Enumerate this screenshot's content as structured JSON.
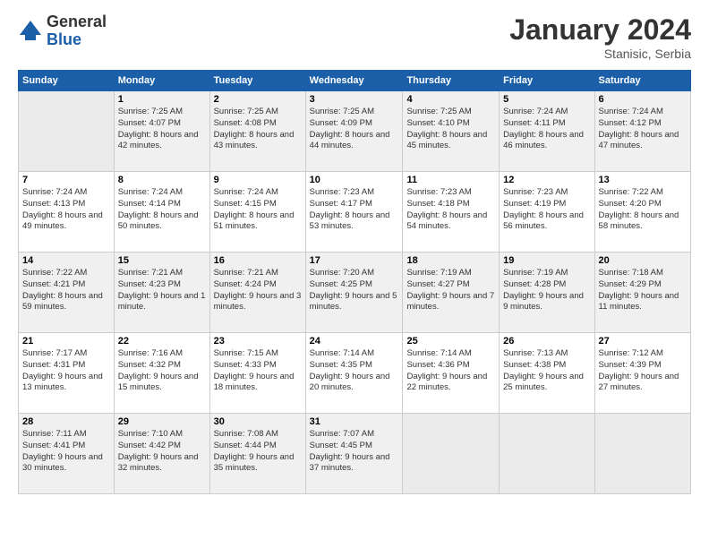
{
  "header": {
    "logo_general": "General",
    "logo_blue": "Blue",
    "month_title": "January 2024",
    "location": "Stanisic, Serbia"
  },
  "days_of_week": [
    "Sunday",
    "Monday",
    "Tuesday",
    "Wednesday",
    "Thursday",
    "Friday",
    "Saturday"
  ],
  "weeks": [
    [
      {
        "day": "",
        "empty": true
      },
      {
        "day": "1",
        "sunrise": "Sunrise: 7:25 AM",
        "sunset": "Sunset: 4:07 PM",
        "daylight": "Daylight: 8 hours and 42 minutes."
      },
      {
        "day": "2",
        "sunrise": "Sunrise: 7:25 AM",
        "sunset": "Sunset: 4:08 PM",
        "daylight": "Daylight: 8 hours and 43 minutes."
      },
      {
        "day": "3",
        "sunrise": "Sunrise: 7:25 AM",
        "sunset": "Sunset: 4:09 PM",
        "daylight": "Daylight: 8 hours and 44 minutes."
      },
      {
        "day": "4",
        "sunrise": "Sunrise: 7:25 AM",
        "sunset": "Sunset: 4:10 PM",
        "daylight": "Daylight: 8 hours and 45 minutes."
      },
      {
        "day": "5",
        "sunrise": "Sunrise: 7:24 AM",
        "sunset": "Sunset: 4:11 PM",
        "daylight": "Daylight: 8 hours and 46 minutes."
      },
      {
        "day": "6",
        "sunrise": "Sunrise: 7:24 AM",
        "sunset": "Sunset: 4:12 PM",
        "daylight": "Daylight: 8 hours and 47 minutes."
      }
    ],
    [
      {
        "day": "7",
        "sunrise": "Sunrise: 7:24 AM",
        "sunset": "Sunset: 4:13 PM",
        "daylight": "Daylight: 8 hours and 49 minutes."
      },
      {
        "day": "8",
        "sunrise": "Sunrise: 7:24 AM",
        "sunset": "Sunset: 4:14 PM",
        "daylight": "Daylight: 8 hours and 50 minutes."
      },
      {
        "day": "9",
        "sunrise": "Sunrise: 7:24 AM",
        "sunset": "Sunset: 4:15 PM",
        "daylight": "Daylight: 8 hours and 51 minutes."
      },
      {
        "day": "10",
        "sunrise": "Sunrise: 7:23 AM",
        "sunset": "Sunset: 4:17 PM",
        "daylight": "Daylight: 8 hours and 53 minutes."
      },
      {
        "day": "11",
        "sunrise": "Sunrise: 7:23 AM",
        "sunset": "Sunset: 4:18 PM",
        "daylight": "Daylight: 8 hours and 54 minutes."
      },
      {
        "day": "12",
        "sunrise": "Sunrise: 7:23 AM",
        "sunset": "Sunset: 4:19 PM",
        "daylight": "Daylight: 8 hours and 56 minutes."
      },
      {
        "day": "13",
        "sunrise": "Sunrise: 7:22 AM",
        "sunset": "Sunset: 4:20 PM",
        "daylight": "Daylight: 8 hours and 58 minutes."
      }
    ],
    [
      {
        "day": "14",
        "sunrise": "Sunrise: 7:22 AM",
        "sunset": "Sunset: 4:21 PM",
        "daylight": "Daylight: 8 hours and 59 minutes."
      },
      {
        "day": "15",
        "sunrise": "Sunrise: 7:21 AM",
        "sunset": "Sunset: 4:23 PM",
        "daylight": "Daylight: 9 hours and 1 minute."
      },
      {
        "day": "16",
        "sunrise": "Sunrise: 7:21 AM",
        "sunset": "Sunset: 4:24 PM",
        "daylight": "Daylight: 9 hours and 3 minutes."
      },
      {
        "day": "17",
        "sunrise": "Sunrise: 7:20 AM",
        "sunset": "Sunset: 4:25 PM",
        "daylight": "Daylight: 9 hours and 5 minutes."
      },
      {
        "day": "18",
        "sunrise": "Sunrise: 7:19 AM",
        "sunset": "Sunset: 4:27 PM",
        "daylight": "Daylight: 9 hours and 7 minutes."
      },
      {
        "day": "19",
        "sunrise": "Sunrise: 7:19 AM",
        "sunset": "Sunset: 4:28 PM",
        "daylight": "Daylight: 9 hours and 9 minutes."
      },
      {
        "day": "20",
        "sunrise": "Sunrise: 7:18 AM",
        "sunset": "Sunset: 4:29 PM",
        "daylight": "Daylight: 9 hours and 11 minutes."
      }
    ],
    [
      {
        "day": "21",
        "sunrise": "Sunrise: 7:17 AM",
        "sunset": "Sunset: 4:31 PM",
        "daylight": "Daylight: 9 hours and 13 minutes."
      },
      {
        "day": "22",
        "sunrise": "Sunrise: 7:16 AM",
        "sunset": "Sunset: 4:32 PM",
        "daylight": "Daylight: 9 hours and 15 minutes."
      },
      {
        "day": "23",
        "sunrise": "Sunrise: 7:15 AM",
        "sunset": "Sunset: 4:33 PM",
        "daylight": "Daylight: 9 hours and 18 minutes."
      },
      {
        "day": "24",
        "sunrise": "Sunrise: 7:14 AM",
        "sunset": "Sunset: 4:35 PM",
        "daylight": "Daylight: 9 hours and 20 minutes."
      },
      {
        "day": "25",
        "sunrise": "Sunrise: 7:14 AM",
        "sunset": "Sunset: 4:36 PM",
        "daylight": "Daylight: 9 hours and 22 minutes."
      },
      {
        "day": "26",
        "sunrise": "Sunrise: 7:13 AM",
        "sunset": "Sunset: 4:38 PM",
        "daylight": "Daylight: 9 hours and 25 minutes."
      },
      {
        "day": "27",
        "sunrise": "Sunrise: 7:12 AM",
        "sunset": "Sunset: 4:39 PM",
        "daylight": "Daylight: 9 hours and 27 minutes."
      }
    ],
    [
      {
        "day": "28",
        "sunrise": "Sunrise: 7:11 AM",
        "sunset": "Sunset: 4:41 PM",
        "daylight": "Daylight: 9 hours and 30 minutes."
      },
      {
        "day": "29",
        "sunrise": "Sunrise: 7:10 AM",
        "sunset": "Sunset: 4:42 PM",
        "daylight": "Daylight: 9 hours and 32 minutes."
      },
      {
        "day": "30",
        "sunrise": "Sunrise: 7:08 AM",
        "sunset": "Sunset: 4:44 PM",
        "daylight": "Daylight: 9 hours and 35 minutes."
      },
      {
        "day": "31",
        "sunrise": "Sunrise: 7:07 AM",
        "sunset": "Sunset: 4:45 PM",
        "daylight": "Daylight: 9 hours and 37 minutes."
      },
      {
        "day": "",
        "empty": true
      },
      {
        "day": "",
        "empty": true
      },
      {
        "day": "",
        "empty": true
      }
    ]
  ]
}
